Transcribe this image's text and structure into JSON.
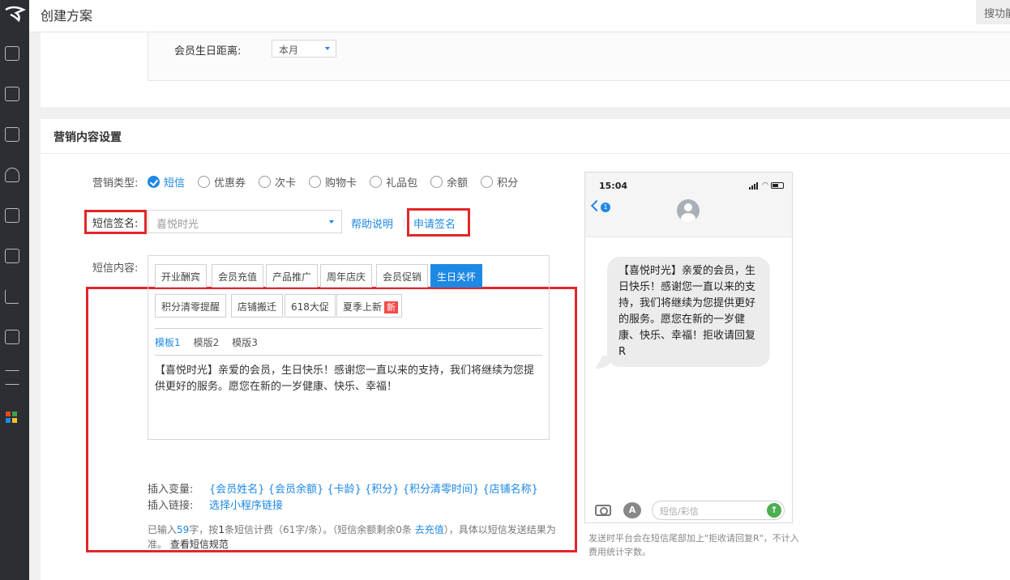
{
  "header": {
    "title": "创建方案",
    "search_label": "搜功能"
  },
  "filters": {
    "birthday_label": "会员生日距离:",
    "birthday_value": "本月"
  },
  "section": {
    "title": "营销内容设置"
  },
  "marketing_type": {
    "label": "营销类型:",
    "options": [
      {
        "label": "短信",
        "checked": true
      },
      {
        "label": "优惠券",
        "checked": false
      },
      {
        "label": "次卡",
        "checked": false
      },
      {
        "label": "购物卡",
        "checked": false
      },
      {
        "label": "礼品包",
        "checked": false
      },
      {
        "label": "余额",
        "checked": false
      },
      {
        "label": "积分",
        "checked": false
      }
    ]
  },
  "signature": {
    "label": "短信签名:",
    "placeholder": "喜悦时光",
    "help_link": "帮助说明",
    "apply_link": "申请签名"
  },
  "content": {
    "label": "短信内容:",
    "categories": [
      "开业酬宾",
      "会员充值",
      "产品推广",
      "周年店庆",
      "会员促销",
      "生日关怀",
      "积分清零提醒",
      "店铺搬迁",
      "618大促",
      "夏季上新"
    ],
    "active_category": "生日关怀",
    "new_badge": "新",
    "tabs": [
      "模板1",
      "模版2",
      "模版3"
    ],
    "text": "【喜悦时光】亲爱的会员，生日快乐！感谢您一直以来的支持，我们将继续为您提供更好的服务。愿您在新的一岁健康、快乐、幸福！"
  },
  "insert": {
    "var_label": "插入变量:",
    "vars": "{会员姓名} {会员余额} {卡龄} {积分} {积分清零时间} {店铺名称}",
    "link_label": "插入链接:",
    "link_text": "选择小程序链接"
  },
  "hint": {
    "p1": "已输入",
    "count": "59",
    "p2": "字，按",
    "sms_count": "1",
    "p3": "条短信计费（61字/条）。（短信余额剩余0条",
    "recharge": "去充值",
    "p4": "），具体以短信发送结果为准。",
    "rules": "查看短信规范"
  },
  "phone": {
    "time": "15:04",
    "back_badge": "1",
    "message": "【喜悦时光】亲爱的会员，生日快乐！感谢您一直以来的支持，我们将继续为您提供更好的服务。愿您在新的一岁健康、快乐、幸福！拒收请回复R",
    "input_placeholder": "短信/彩信",
    "appstore_glyph": "A",
    "send_glyph": "↑",
    "note": "发送时平台会在短信尾部加上\"拒收请回复R\"，不计入费用统计字数。"
  },
  "colors": {
    "accent": "#1e88e5",
    "highlight": "#e2262b",
    "sidebar": "#2b2e33",
    "badge": "#f24b4b"
  }
}
